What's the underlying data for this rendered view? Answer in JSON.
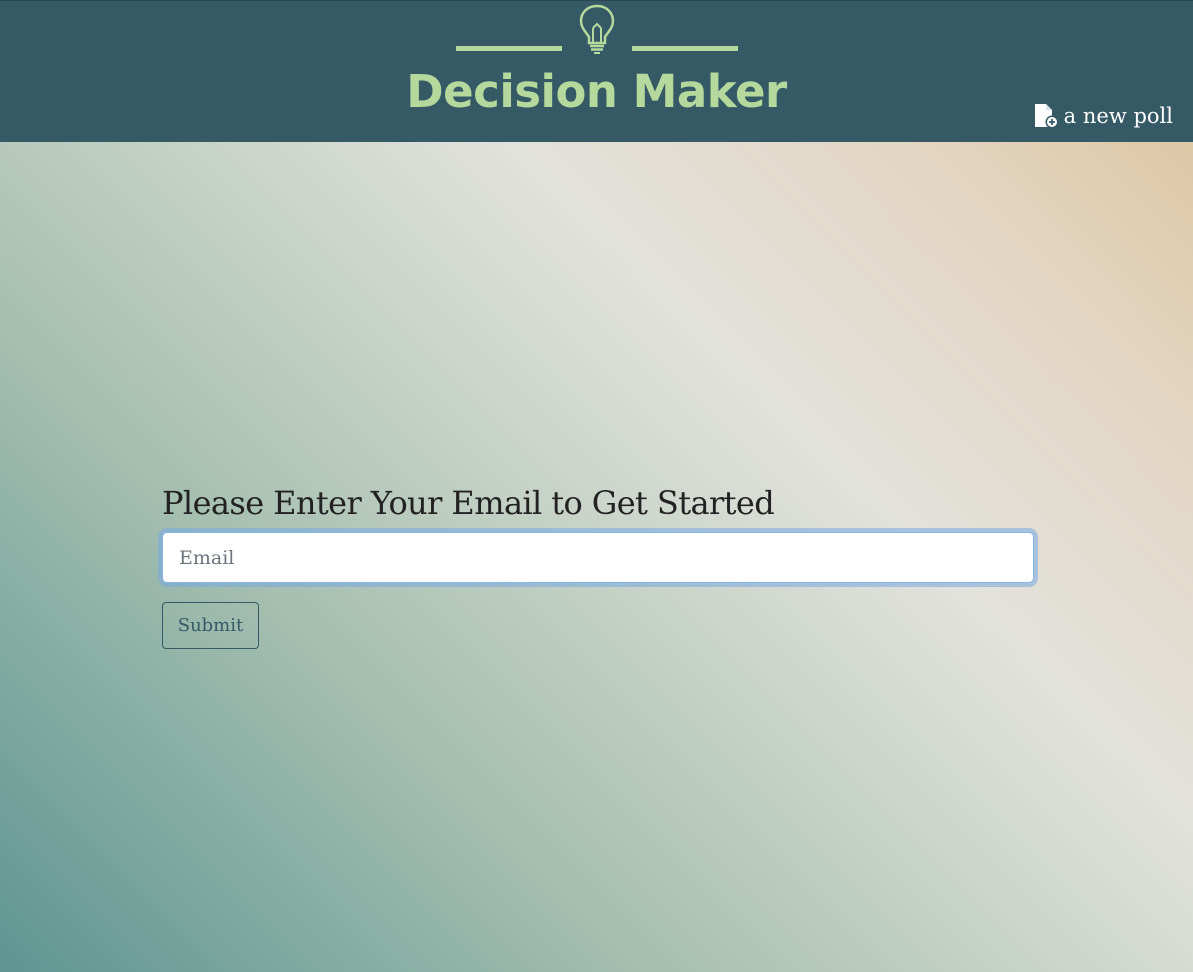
{
  "header": {
    "logo_title": "Decision Maker",
    "logo_icon": "lightbulb-icon",
    "new_poll_icon": "file-add-icon",
    "new_poll_label": "a new poll"
  },
  "form": {
    "prompt": "Please Enter Your Email to Get Started",
    "email_placeholder": "Email",
    "email_value": "",
    "submit_label": "Submit"
  },
  "colors": {
    "header_bg": "#355a66",
    "logo_accent": "#b5d99c",
    "button_border": "#355a66"
  }
}
